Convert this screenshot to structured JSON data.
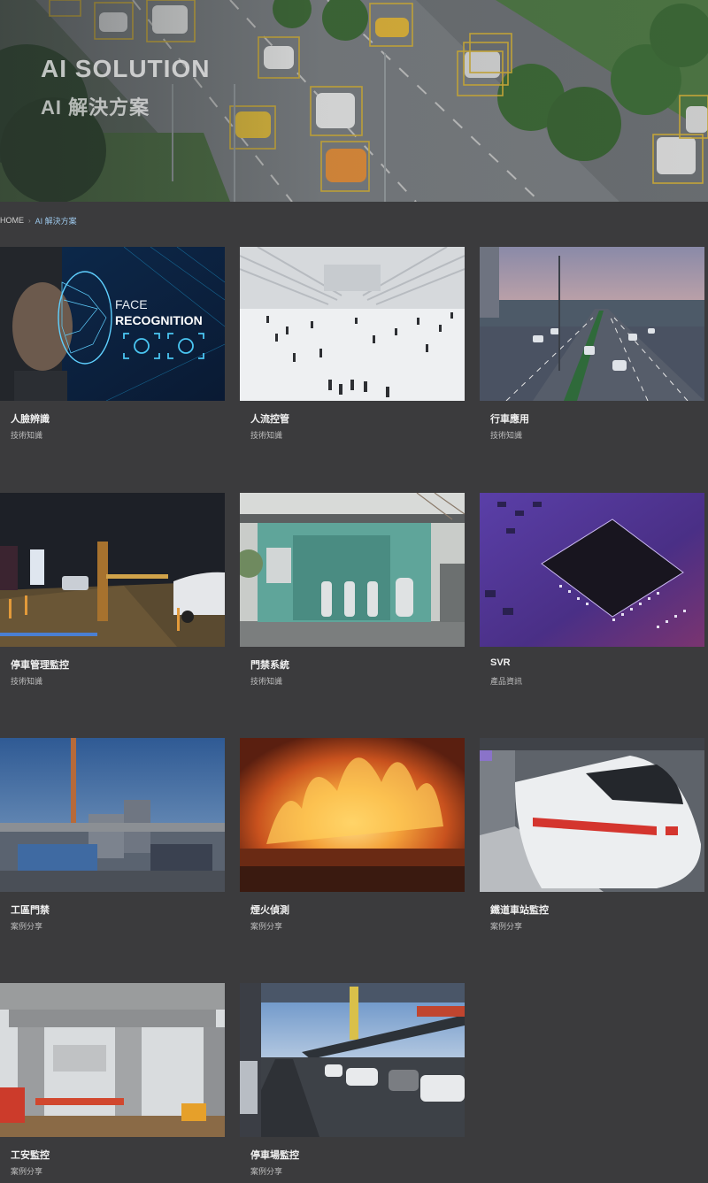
{
  "hero": {
    "title": "AI SOLUTION",
    "subtitle": "AI 解決方案"
  },
  "breadcrumb": {
    "home": "HOME",
    "current": "AI 解決方案"
  },
  "thumb_text": {
    "face_line1": "FACE",
    "face_line2": "RECOGNITION"
  },
  "cards": [
    {
      "title": "人臉辨識",
      "tag": "技術知識"
    },
    {
      "title": "人流控管",
      "tag": "技術知識"
    },
    {
      "title": "行車應用",
      "tag": "技術知識"
    },
    {
      "title": "停車管理監控",
      "tag": "技術知識"
    },
    {
      "title": "門禁系統",
      "tag": "技術知識"
    },
    {
      "title": "SVR",
      "tag": "產品資訊"
    },
    {
      "title": "工區門禁",
      "tag": "案例分享"
    },
    {
      "title": "煙火偵測",
      "tag": "案例分享"
    },
    {
      "title": "鐵道車站監控",
      "tag": "案例分享"
    },
    {
      "title": "工安監控",
      "tag": "案例分享"
    },
    {
      "title": "停車場監控",
      "tag": "案例分享"
    }
  ]
}
